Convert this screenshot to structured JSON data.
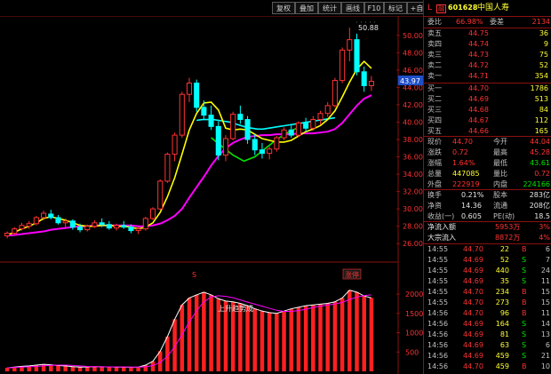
{
  "toolbar": {
    "buttons": [
      "复权",
      "叠加",
      "统计",
      "画线",
      "F10",
      "标记",
      "自选"
    ],
    "icon_names": [
      "left-arrow-icon",
      "right-arrow-icon"
    ]
  },
  "main_chart": {
    "yaxis_ticks": [
      "50.00",
      "48.00",
      "46.00",
      "44.00",
      "42.00",
      "40.00",
      "38.00",
      "36.00",
      "34.00",
      "32.00",
      "30.00",
      "28.00",
      "26.00"
    ],
    "price_label": "43.97",
    "high_marker": "50.88",
    "badge": "涨停",
    "mark_s": "S",
    "dot_row": "· · · · ·"
  },
  "indicator": {
    "label": "上升趋势成",
    "yaxis_ticks": [
      "2000",
      "1500",
      "1000",
      "500"
    ]
  },
  "colors": {
    "up": "#ff3232",
    "down": "#00ffff",
    "ma_short": "#ffff00",
    "ma_long": "#ff00ff",
    "ma_mid": "#00ffff",
    "trend": "#00e600"
  },
  "chart_data": {
    "type": "candlestick",
    "ylim": [
      25,
      51
    ],
    "candles": [
      [
        26.9,
        27.4,
        26.6,
        27.2
      ],
      [
        27.2,
        27.9,
        27.0,
        27.7
      ],
      [
        27.7,
        28.4,
        27.5,
        28.1
      ],
      [
        28.0,
        28.6,
        27.7,
        28.3
      ],
      [
        28.3,
        29.2,
        28.1,
        29.0
      ],
      [
        29.0,
        29.8,
        28.7,
        29.5
      ],
      [
        29.4,
        29.9,
        28.8,
        29.0
      ],
      [
        29.0,
        29.3,
        28.2,
        28.4
      ],
      [
        28.4,
        28.9,
        27.9,
        28.6
      ],
      [
        28.6,
        28.8,
        27.6,
        27.9
      ],
      [
        27.9,
        28.3,
        27.3,
        27.6
      ],
      [
        27.6,
        28.2,
        27.4,
        28.0
      ],
      [
        28.0,
        28.7,
        27.8,
        28.4
      ],
      [
        28.4,
        28.9,
        27.9,
        28.2
      ],
      [
        28.2,
        28.6,
        27.6,
        27.8
      ],
      [
        27.8,
        28.3,
        27.5,
        28.1
      ],
      [
        28.1,
        28.6,
        27.7,
        27.9
      ],
      [
        27.9,
        28.2,
        27.2,
        27.5
      ],
      [
        27.5,
        27.9,
        27.1,
        27.7
      ],
      [
        27.7,
        29.1,
        27.5,
        28.9
      ],
      [
        28.9,
        30.2,
        28.7,
        30.0
      ],
      [
        30.0,
        33.4,
        29.9,
        33.2
      ],
      [
        33.2,
        36.5,
        33.0,
        36.3
      ],
      [
        36.3,
        38.8,
        35.5,
        38.5
      ],
      [
        38.5,
        43.5,
        38.2,
        43.2
      ],
      [
        43.2,
        45.1,
        42.3,
        44.5
      ],
      [
        44.5,
        44.9,
        41.2,
        41.7
      ],
      [
        41.7,
        42.5,
        40.3,
        40.8
      ],
      [
        40.8,
        41.9,
        39.1,
        39.5
      ],
      [
        39.5,
        40.1,
        35.6,
        36.2
      ],
      [
        36.2,
        38.5,
        35.5,
        38.1
      ],
      [
        38.1,
        41.2,
        37.9,
        40.9
      ],
      [
        40.9,
        41.9,
        39.8,
        40.3
      ],
      [
        40.3,
        40.7,
        37.5,
        38.0
      ],
      [
        38.0,
        38.6,
        36.2,
        36.8
      ],
      [
        36.8,
        37.6,
        35.8,
        36.4
      ],
      [
        36.4,
        37.2,
        35.7,
        36.9
      ],
      [
        36.9,
        38.4,
        36.6,
        38.2
      ],
      [
        38.2,
        39.4,
        37.9,
        39.1
      ],
      [
        39.1,
        39.8,
        38.2,
        38.5
      ],
      [
        38.5,
        40.1,
        38.3,
        39.9
      ],
      [
        39.9,
        40.5,
        38.9,
        39.3
      ],
      [
        39.3,
        40.7,
        39.0,
        40.3
      ],
      [
        40.3,
        41.3,
        39.7,
        41.0
      ],
      [
        41.0,
        42.3,
        40.6,
        41.9
      ],
      [
        41.9,
        45.1,
        41.7,
        44.8
      ],
      [
        44.8,
        48.6,
        44.5,
        48.3
      ],
      [
        48.3,
        50.88,
        47.0,
        49.5
      ],
      [
        49.5,
        50.2,
        45.4,
        45.8
      ],
      [
        45.8,
        46.4,
        43.5,
        44.2
      ],
      [
        44.2,
        45.3,
        43.6,
        44.7
      ]
    ],
    "ma_short": [
      27.0,
      27.3,
      27.7,
      28.0,
      28.4,
      28.9,
      29.1,
      28.9,
      28.7,
      28.4,
      28.1,
      28.0,
      28.0,
      28.1,
      28.1,
      28.0,
      28.0,
      27.9,
      27.7,
      27.9,
      28.4,
      29.6,
      31.4,
      33.6,
      36.3,
      39.1,
      41.0,
      42.2,
      42.3,
      41.4,
      39.3,
      39.1,
      39.2,
      39.1,
      38.6,
      38.1,
      37.9,
      37.7,
      37.7,
      37.9,
      38.4,
      38.9,
      39.2,
      39.6,
      40.3,
      41.3,
      42.9,
      44.6,
      46.1,
      47.0,
      46.2
    ],
    "ma_long": [
      26.9,
      27.0,
      27.1,
      27.2,
      27.3,
      27.4,
      27.6,
      27.7,
      27.8,
      27.9,
      28.0,
      28.0,
      28.1,
      28.1,
      28.1,
      28.1,
      28.1,
      28.1,
      28.0,
      28.0,
      28.1,
      28.3,
      28.7,
      29.2,
      30.0,
      31.3,
      32.5,
      33.7,
      35.0,
      36.1,
      37.0,
      37.6,
      38.0,
      38.3,
      38.4,
      38.5,
      38.5,
      38.6,
      38.6,
      38.6,
      38.7,
      38.7,
      38.7,
      38.8,
      38.9,
      39.2,
      39.9,
      40.9,
      41.9,
      42.7,
      43.1
    ],
    "ma_mid_range": [
      26,
      45
    ],
    "ma_mid": [
      40.2,
      40.3,
      40.3,
      40.3,
      40.2,
      40.1,
      40.0,
      39.8,
      39.6,
      39.4,
      39.3,
      39.2,
      39.2,
      39.3,
      39.4,
      39.5,
      39.6,
      39.7,
      39.8,
      39.9,
      40.0,
      40.1,
      40.2,
      40.3,
      40.4,
      40.5
    ],
    "trend_line_range": [
      28,
      40
    ],
    "trend_line": [
      38.2,
      37.2,
      36.2,
      35.5,
      36.0,
      37.0,
      38.0,
      38.8,
      39.4
    ],
    "volume_ylim": [
      0,
      2300
    ],
    "volume": [
      90,
      110,
      130,
      140,
      160,
      180,
      170,
      150,
      140,
      120,
      110,
      115,
      120,
      118,
      112,
      110,
      108,
      105,
      110,
      160,
      260,
      520,
      900,
      1350,
      1720,
      1900,
      1980,
      2050,
      1980,
      1880,
      1820,
      1800,
      1760,
      1700,
      1620,
      1560,
      1520,
      1500,
      1560,
      1620,
      1660,
      1700,
      1720,
      1740,
      1760,
      1800,
      1900,
      2100,
      2050,
      1950,
      1900
    ]
  },
  "panel": {
    "header": {
      "prefix": "L",
      "badge": "融",
      "code": "601628",
      "name": "中国人寿"
    },
    "ratio_row": {
      "l1": "委比",
      "v1": "66.98%",
      "l2": "委差",
      "v2": "2134"
    },
    "asks": [
      {
        "label": "卖五",
        "price": "44.75",
        "vol": "36"
      },
      {
        "label": "卖四",
        "price": "44.74",
        "vol": "9"
      },
      {
        "label": "卖三",
        "price": "44.73",
        "vol": "75"
      },
      {
        "label": "卖二",
        "price": "44.72",
        "vol": "52"
      },
      {
        "label": "卖一",
        "price": "44.71",
        "vol": "354"
      }
    ],
    "bids": [
      {
        "label": "买一",
        "price": "44.70",
        "vol": "1786"
      },
      {
        "label": "买二",
        "price": "44.69",
        "vol": "513"
      },
      {
        "label": "买三",
        "price": "44.68",
        "vol": "84"
      },
      {
        "label": "买四",
        "price": "44.67",
        "vol": "112"
      },
      {
        "label": "买五",
        "price": "44.66",
        "vol": "165"
      }
    ],
    "quote": [
      {
        "l1": "现价",
        "v1": "44.70",
        "l2": "今开",
        "v2": "44.04"
      },
      {
        "l1": "涨跌",
        "v1": "0.72",
        "l2": "最高",
        "v2": "45.28"
      },
      {
        "l1": "涨幅",
        "v1": "1.64%",
        "l2": "最低",
        "v2": "43.61"
      },
      {
        "l1": "总量",
        "v1": "447085",
        "l2": "量比",
        "v2": "0.72"
      },
      {
        "l1": "外盘",
        "v1": "222919",
        "l2": "内盘",
        "v2": "224166"
      }
    ],
    "stats": [
      {
        "l1": "换手",
        "v1": "0.21%",
        "l2": "股本",
        "v2": "283亿"
      },
      {
        "l1": "净资",
        "v1": "14.36",
        "l2": "流通",
        "v2": "208亿"
      },
      {
        "l1": "收益(一)",
        "v1": "0.605",
        "l2": "PE(动)",
        "v2": "18.5"
      }
    ],
    "flows": [
      {
        "label": "净流入额",
        "value": "5953万",
        "pct": "3%"
      },
      {
        "label": "大宗流入",
        "value": "8872万",
        "pct": "4%"
      }
    ],
    "ticks": [
      {
        "time": "14:55",
        "price": "44.70",
        "vol": "22",
        "side": "B",
        "n": "6"
      },
      {
        "time": "14:55",
        "price": "44.69",
        "vol": "52",
        "side": "S",
        "n": "7"
      },
      {
        "time": "14:55",
        "price": "44.69",
        "vol": "440",
        "side": "S",
        "n": "24"
      },
      {
        "time": "14:55",
        "price": "44.69",
        "vol": "35",
        "side": "S",
        "n": "11"
      },
      {
        "time": "14:55",
        "price": "44.70",
        "vol": "234",
        "side": "B",
        "n": "15"
      },
      {
        "time": "14:55",
        "price": "44.70",
        "vol": "273",
        "side": "B",
        "n": "15"
      },
      {
        "time": "14:56",
        "price": "44.70",
        "vol": "96",
        "side": "B",
        "n": "11"
      },
      {
        "time": "14:56",
        "price": "44.69",
        "vol": "164",
        "side": "S",
        "n": "14"
      },
      {
        "time": "14:56",
        "price": "44.69",
        "vol": "81",
        "side": "S",
        "n": "13"
      },
      {
        "time": "14:56",
        "price": "44.69",
        "vol": "63",
        "side": "S",
        "n": "6"
      },
      {
        "time": "14:56",
        "price": "44.69",
        "vol": "459",
        "side": "S",
        "n": "21"
      },
      {
        "time": "14:56",
        "price": "44.70",
        "vol": "459",
        "side": "B",
        "n": "10"
      }
    ]
  }
}
